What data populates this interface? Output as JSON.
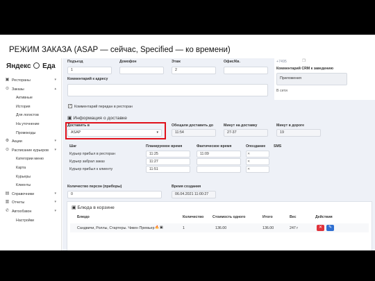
{
  "slide": {
    "title": "РЕЖИМ ЗАКАЗА (ASAP — сейчас, Specified — ко времени)"
  },
  "logo": {
    "brand": "Яндекс",
    "product": "Еда"
  },
  "sidebar": {
    "items": [
      {
        "label": "Рестораны",
        "icon": "▣",
        "chev": "▾"
      },
      {
        "label": "Заказы",
        "icon": "⊙",
        "chev": "▴"
      },
      {
        "label": "Активные"
      },
      {
        "label": "История"
      },
      {
        "label": "Для логистов"
      },
      {
        "label": "На уточнение"
      },
      {
        "label": "Промокоды"
      },
      {
        "label": "Акции",
        "icon": "⚙",
        "chev": "▾"
      },
      {
        "label": "Расписание курьеров",
        "icon": "⊙",
        "chev": "▾"
      },
      {
        "label": "Категории меню"
      },
      {
        "label": "Карта"
      },
      {
        "label": "Курьеры"
      },
      {
        "label": "Клиенты"
      },
      {
        "label": "Справочники",
        "icon": "▤",
        "chev": "▾"
      },
      {
        "label": "Отчеты",
        "icon": "▥",
        "chev": "▾"
      },
      {
        "label": "Автообзвон",
        "icon": "✆",
        "chev": "▾"
      },
      {
        "label": "Настройки"
      }
    ]
  },
  "address": {
    "entrance_label": "Подъезд",
    "entrance_value": "1",
    "intercom_label": "Домофон",
    "intercom_value": "",
    "floor_label": "Этаж",
    "floor_value": "2",
    "office_label": "Офис/Кв.",
    "office_value": ""
  },
  "comment": {
    "label": "Комментарий к адресу",
    "value": "",
    "passed_label": "Комментарий передан в ресторан",
    "passed_checked": true
  },
  "right_col": {
    "phone": "+7495",
    "crm_label": "Комментарий CRM к заведению",
    "app_value": "Приложения",
    "online": "В сети"
  },
  "delivery": {
    "section_title": "Информация о доставке",
    "mode_label": "Доставить в",
    "mode_value": "ASAP",
    "promised_label": "Обещали доставить до",
    "promised_value": "11:54",
    "minutes_label": "Минут на доставку",
    "minutes_value": "27-37",
    "road_label": "Минут в дороге",
    "road_value": "19"
  },
  "steps": {
    "headers": [
      "Шаг",
      "Планируемое время",
      "Фактическое время",
      "Опоздание",
      "SMS"
    ],
    "rows": [
      {
        "step": "Курьер прибыл в ресторан",
        "planned": "11:25",
        "actual": "11:09",
        "late": ""
      },
      {
        "step": "Курьер забрал заказ",
        "planned": "11:27",
        "actual": "",
        "late": ""
      },
      {
        "step": "Курьер прибыл к клиенту",
        "planned": "11:51",
        "actual": "",
        "late": ""
      }
    ]
  },
  "persons": {
    "label": "Количество персон (приборы)",
    "value": "0"
  },
  "created": {
    "label": "Время создания",
    "value": "06.04.2021 11:00:27"
  },
  "cart": {
    "title": "Блюда в корзине",
    "headers": [
      "Блюдо",
      "Количество",
      "Стоимость одного",
      "Итого",
      "Вес",
      "Действия"
    ],
    "rows": [
      {
        "dish": "Сандвичи, Роллы, Стартеры. Чикен Премьер",
        "qty": "1",
        "price": "136.00",
        "total": "136.00",
        "weight": "247 г"
      }
    ]
  },
  "colors": {
    "highlight": "#e0101a",
    "delete_button": "#e0323b",
    "edit_button": "#2f6fd1"
  }
}
